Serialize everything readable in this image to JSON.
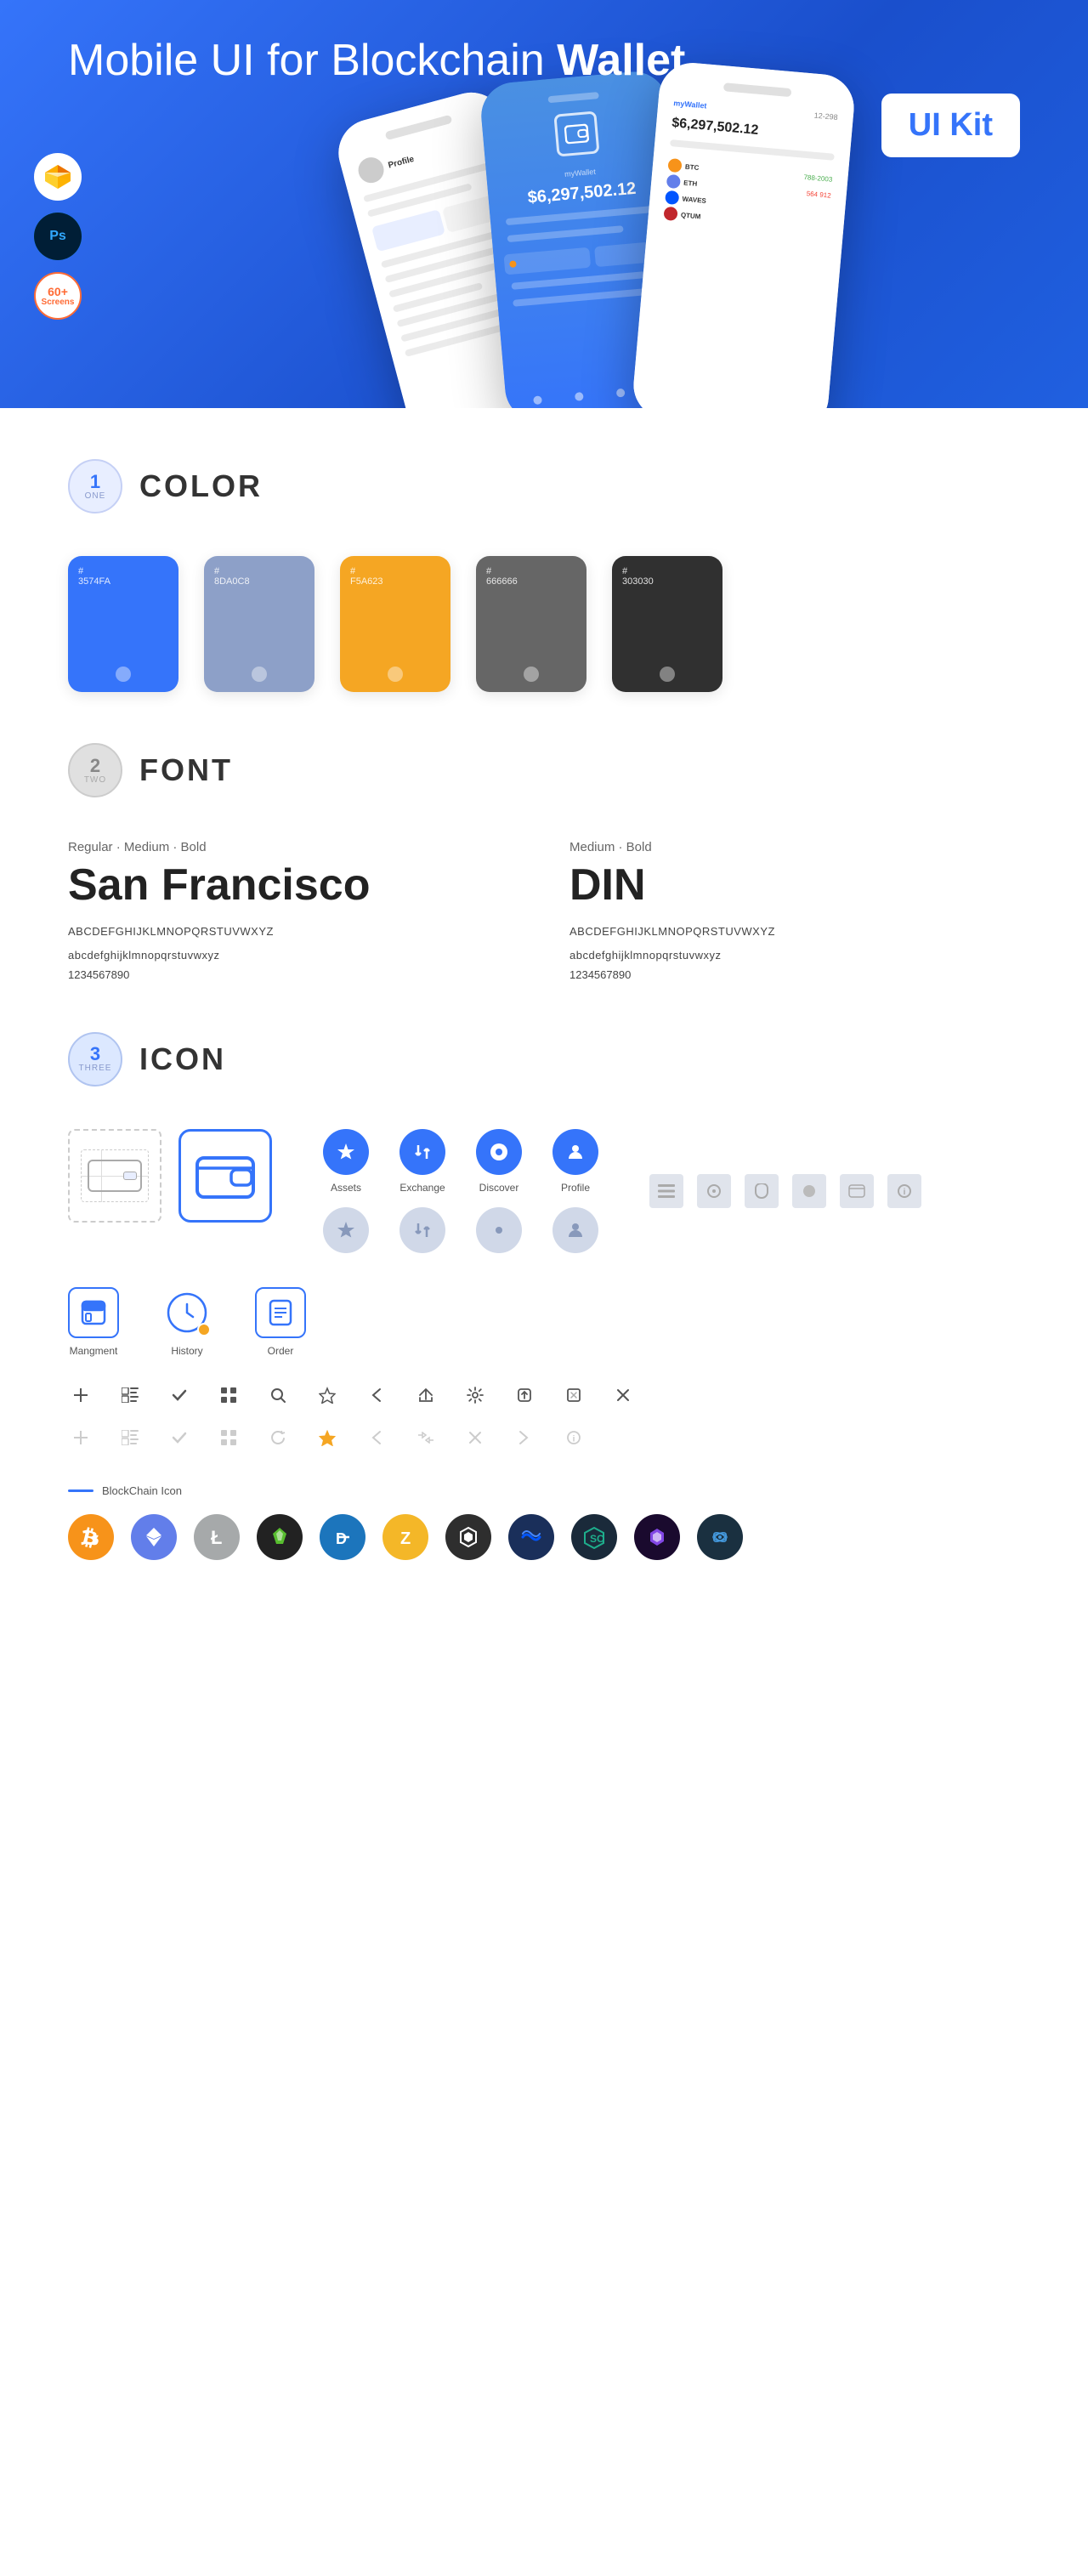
{
  "hero": {
    "title_normal": "Mobile UI for Blockchain ",
    "title_bold": "Wallet",
    "badge": "UI Kit",
    "badges": [
      {
        "id": "sketch",
        "label": "Sketch"
      },
      {
        "id": "ps",
        "label": "Ps"
      },
      {
        "id": "screens",
        "line1": "60+",
        "line2": "Screens"
      }
    ]
  },
  "sections": {
    "color": {
      "number": "1",
      "number_word": "ONE",
      "title": "COLOR",
      "swatches": [
        {
          "hex": "#3574FA",
          "label": "3574FA"
        },
        {
          "hex": "#8DA0C8",
          "label": "8DA0C8"
        },
        {
          "hex": "#F5A623",
          "label": "F5A623"
        },
        {
          "hex": "#666666",
          "label": "666666"
        },
        {
          "hex": "#303030",
          "label": "303030"
        }
      ]
    },
    "font": {
      "number": "2",
      "number_word": "TWO",
      "title": "FONT",
      "fonts": [
        {
          "weights": "Regular · Medium · Bold",
          "name": "San Francisco",
          "uppercase": "ABCDEFGHIJKLMNOPQRSTUVWXYZ",
          "lowercase": "abcdefghijklmnopqrstuvwxyz",
          "numbers": "1234567890"
        },
        {
          "weights": "Medium · Bold",
          "name": "DIN",
          "uppercase": "ABCDEFGHIJKLMNOPQRSTUVWXYZ",
          "lowercase": "abcdefghijklmnopqrstuvwxyz",
          "numbers": "1234567890"
        }
      ]
    },
    "icon": {
      "number": "3",
      "number_word": "THREE",
      "title": "ICON",
      "nav_icons": [
        {
          "label": "Assets",
          "style": "blue"
        },
        {
          "label": "Exchange",
          "style": "blue"
        },
        {
          "label": "Discover",
          "style": "blue"
        },
        {
          "label": "Profile",
          "style": "blue"
        },
        {
          "label": "Assets",
          "style": "gray"
        },
        {
          "label": "Exchange",
          "style": "gray"
        },
        {
          "label": "Discover",
          "style": "gray"
        },
        {
          "label": "Profile",
          "style": "gray"
        }
      ],
      "action_icons": [
        {
          "label": "Mangment",
          "style": "blue-box"
        },
        {
          "label": "History",
          "style": "clock"
        },
        {
          "label": "Order",
          "style": "blue-box"
        }
      ],
      "toolbar_icons_1": [
        "+",
        "📋",
        "✓",
        "⊞",
        "🔍",
        "☆",
        "‹",
        "‹‹",
        "⚙",
        "⬛",
        "⤢",
        "✕"
      ],
      "toolbar_icons_2": [
        "+",
        "📋",
        "✓",
        "⊞",
        "⟲",
        "☆",
        "‹",
        "‹‹",
        "✕",
        "→",
        "ℹ"
      ],
      "blockchain_label": "BlockChain Icon",
      "crypto_coins": [
        {
          "id": "btc",
          "symbol": "₿",
          "color": "#F7931A",
          "label": "Bitcoin"
        },
        {
          "id": "eth",
          "symbol": "Ξ",
          "color": "#627EEA",
          "label": "Ethereum"
        },
        {
          "id": "ltc",
          "symbol": "Ł",
          "color": "#A6A9AA",
          "label": "Litecoin"
        },
        {
          "id": "neo",
          "symbol": "◆",
          "color": "#58BE2F",
          "label": "NEO"
        },
        {
          "id": "dash",
          "symbol": "Đ",
          "color": "#1C75BC",
          "label": "Dash"
        },
        {
          "id": "zcash",
          "symbol": "Z",
          "color": "#F4B728",
          "label": "Zcash"
        },
        {
          "id": "iota",
          "symbol": "⬡",
          "color": "#2e2e2e",
          "label": "IOTA"
        },
        {
          "id": "waves",
          "symbol": "≋",
          "color": "#0155FF",
          "label": "Waves"
        },
        {
          "id": "siacoin",
          "symbol": "⬦",
          "color": "#1eae8c",
          "label": "Siacoin"
        },
        {
          "id": "matic",
          "symbol": "⬡",
          "color": "#8247E5",
          "label": "Polygon"
        },
        {
          "id": "other",
          "symbol": "●",
          "color": "#14b6e7",
          "label": "Stellar"
        }
      ]
    }
  }
}
